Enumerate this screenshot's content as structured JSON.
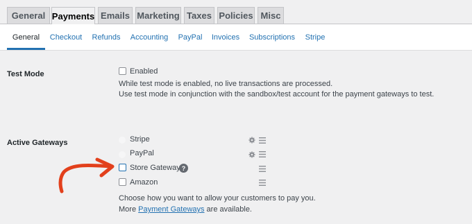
{
  "top_tabs": [
    {
      "label": "General"
    },
    {
      "label": "Payments"
    },
    {
      "label": "Emails"
    },
    {
      "label": "Marketing"
    },
    {
      "label": "Taxes"
    },
    {
      "label": "Policies"
    },
    {
      "label": "Misc"
    }
  ],
  "sub_tabs": [
    {
      "label": "General"
    },
    {
      "label": "Checkout"
    },
    {
      "label": "Refunds"
    },
    {
      "label": "Accounting"
    },
    {
      "label": "PayPal"
    },
    {
      "label": "Invoices"
    },
    {
      "label": "Subscriptions"
    },
    {
      "label": "Stripe"
    }
  ],
  "test_mode": {
    "label": "Test Mode",
    "checkbox_label": "Enabled",
    "desc1": "While test mode is enabled, no live transactions are processed.",
    "desc2": "Use test mode in conjunction with the sandbox/test account for the payment gateways to test."
  },
  "gateways": {
    "label": "Active Gateways",
    "items": [
      {
        "label": "Stripe"
      },
      {
        "label": "PayPal"
      },
      {
        "label": "Store Gateway"
      },
      {
        "label": "Amazon"
      }
    ],
    "help_glyph": "?",
    "desc1": "Choose how you want to allow your customers to pay you.",
    "desc2_prefix": "More ",
    "desc2_link": "Payment Gateways",
    "desc2_suffix": " are available."
  },
  "colors": {
    "accent": "#2271b1",
    "arrow": "#e2401c"
  }
}
